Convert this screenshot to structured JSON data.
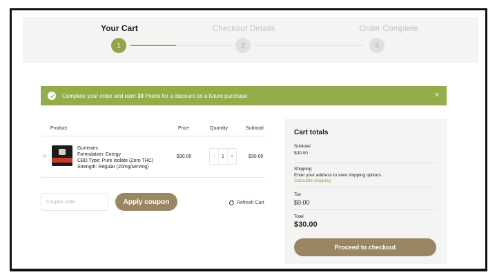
{
  "steps": [
    {
      "label": "Your Cart",
      "number": "1",
      "state": "active"
    },
    {
      "label": "Checkout Details",
      "number": "2",
      "state": "inactive"
    },
    {
      "label": "Order Complete",
      "number": "3",
      "state": "inactive"
    }
  ],
  "notice": {
    "prefix": "Complete your order and earn ",
    "points": "30",
    "suffix": " Points for a discount on a future purchase",
    "close": "✕"
  },
  "table": {
    "headers": {
      "product": "Product",
      "price": "Price",
      "quantity": "Quantity",
      "subtotal": "Subtotal"
    },
    "item": {
      "remove": "✕",
      "name": "Gummies",
      "formulation": "Formulation: Energy",
      "cbd_type": "CBD Type: Pure Isolate (Zero THC)",
      "strength": "Strength: Regular (20mg/serving)",
      "price": "$30.00",
      "qty_minus": "-",
      "quantity": "1",
      "qty_plus": "+",
      "subtotal": "$30.00"
    }
  },
  "coupon": {
    "placeholder": "Coupon code",
    "apply_label": "Apply coupon"
  },
  "refresh": {
    "label": "Refresh Cart"
  },
  "totals": {
    "title": "Cart totals",
    "subtotal_label": "Subtotal",
    "subtotal_value": "$30.00",
    "shipping_label": "Shipping",
    "shipping_text": "Enter your address to view shipping options.",
    "calculate_link": "Calculate shipping",
    "tax_label": "Tax",
    "tax_value": "$0.00",
    "total_label": "Total",
    "total_value": "$30.00",
    "checkout_label": "Proceed to checkout"
  },
  "colors": {
    "accent_green": "#93ad4a",
    "button_brown": "#9a8662"
  }
}
